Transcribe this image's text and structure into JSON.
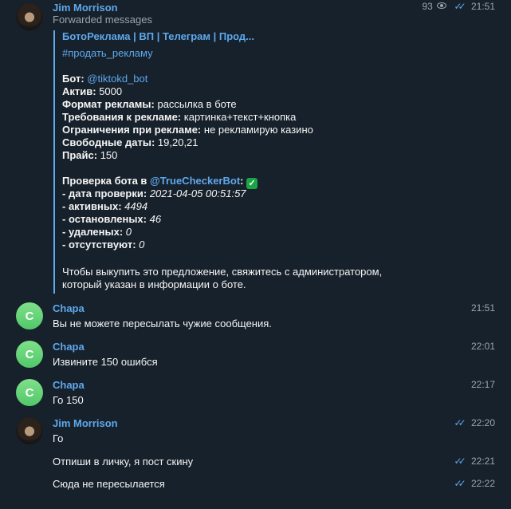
{
  "messages": {
    "m1": {
      "sender": "Jim Morrison",
      "subtitle": "Forwarded messages",
      "views": "93",
      "time": "21:51",
      "forward": {
        "title": "БотоРеклама | ВП | Телеграм | Прод...",
        "hashtag": "#продать_рекламу",
        "bot_label": "Бот:",
        "bot_value": "@tiktokd_bot",
        "active_label": "Актив:",
        "active_value": "5000",
        "format_label": "Формат рекламы:",
        "format_value": "рассылка в боте",
        "req_label": "Требования к рекламе:",
        "req_value": "картинка+текст+кнопка",
        "limit_label": "Ограничения при рекламе:",
        "limit_value": "не рекламирую казино",
        "dates_label": "Свободные даты:",
        "dates_value": "19,20,21",
        "price_label": "Прайс:",
        "price_value": "150",
        "check_label": "Проверка бота в",
        "check_bot": "@TrueCheckerBot",
        "check_colon": ":",
        "check_emoji": "✓",
        "date_label": "- дата проверки:",
        "date_value": "2021-04-05 00:51:57",
        "act_label": "- активных:",
        "act_value": "4494",
        "stop_label": "- остановленых:",
        "stop_value": "46",
        "del_label": "- удаленых:",
        "del_value": "0",
        "abs_label": "- отсутствуют:",
        "abs_value": "0",
        "footer1": "Чтобы выкупить это предложение, свяжитесь с администратором,",
        "footer2": "который указан в информации о боте."
      }
    },
    "m2": {
      "initial": "C",
      "sender": "Chapa",
      "text": "Вы не можете пересылать чужие сообщения.",
      "time": "21:51"
    },
    "m3": {
      "initial": "C",
      "sender": "Chapa",
      "text": "Извините 150 ошибся",
      "time": "22:01"
    },
    "m4": {
      "initial": "C",
      "sender": "Chapa",
      "text": "Го 150",
      "time": "22:17"
    },
    "m5": {
      "sender": "Jim Morrison",
      "text": "Го",
      "time": "22:20"
    },
    "m6": {
      "text": "Отпиши в личку, я пост скину",
      "time": "22:21"
    },
    "m7": {
      "text": "Сюда не пересылается",
      "time": "22:22"
    }
  },
  "colors": {
    "background": "#17212b",
    "accent": "#5ea8ec",
    "avatar_green": "#52c86a",
    "muted": "#9aa5b1"
  },
  "icons": {
    "read_receipt": "double-check-icon",
    "views": "eye-icon",
    "verified": "check-box-emoji"
  }
}
